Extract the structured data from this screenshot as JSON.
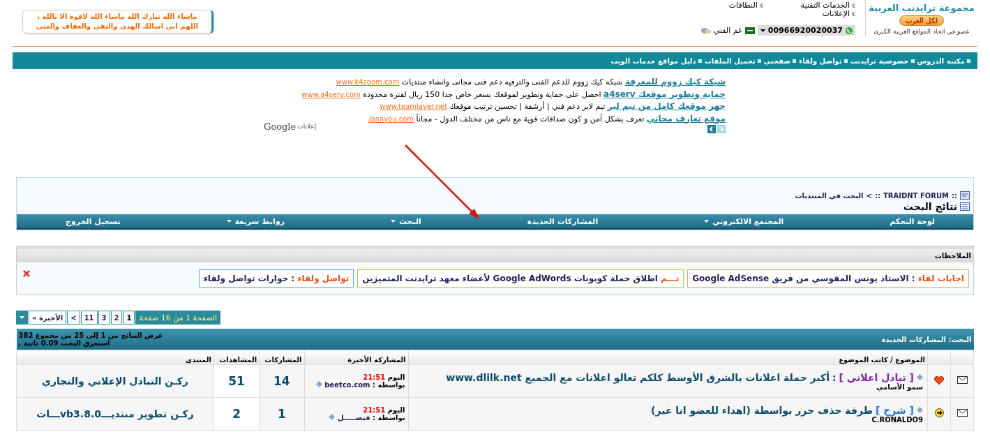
{
  "header": {
    "logo": {
      "title": "مجموعة ترايدنت العربية",
      "button": "لكل العرب",
      "tagline": "عضو في اتحاد المواقع العربية الكبرى"
    },
    "links": [
      "الخدمات التقنية",
      "النطاقات",
      "الإعلانات"
    ],
    "phone": "00966920020037",
    "support": "غم الفني",
    "dua": "ماشاء الله تبارك الله ماشاء الله لاقوة الا بالله ، اللهم اني اسالك الهدى والتقى والعفاف والغنى"
  },
  "nav": [
    "مكتبة الدروس",
    "خصوصية ترايدنت",
    "تواصل ولقاء",
    "صفحتي",
    "تحميل الملفات",
    "دليل مواقع خدمات الويب"
  ],
  "ads": {
    "items": [
      {
        "title": "شبكة كيك زووم للمعرفة",
        "text": "شبكه كيك زووم للدعم الفنى والترفيه دعم فنى مجانى وانشاء منتديات",
        "url": "www.k4zoom.com"
      },
      {
        "title": "حماية وتطوير موقعك a4serv",
        "text": "احصل على حماية وتطوير لموقعك بسعر خاص جدا 150 ريال لفترة محدودة",
        "url": "www.a4serv.com"
      },
      {
        "title": "جهز موقعك كامل من تيم لير",
        "text": "تيم لاير دعم فني | أرشفة | تحسين ترتيب موقعك",
        "url": "www.teamlayer.net"
      },
      {
        "title": "موقع تعارف مجاني",
        "text": "تعرف بشكل آمن و كون صداقات قوية مع ناس من مختلف الدول - مجاناً",
        "url": "anayou.com/"
      }
    ],
    "label": "إعلانات",
    "brand": "Google"
  },
  "breadcrumb": {
    "forum": "TRAIDNT FORUM",
    "sep": "::",
    "arrow": ">",
    "current": "البحث في المنتديات",
    "title": "نتائج البحث"
  },
  "menu": [
    {
      "label": "لوحة التحكم",
      "dropdown": false
    },
    {
      "label": "المجتمع الالكتروني",
      "dropdown": true
    },
    {
      "label": "المشاركات الجديدة",
      "dropdown": false
    },
    {
      "label": "البحث",
      "dropdown": true
    },
    {
      "label": "روابط سريعة",
      "dropdown": true
    },
    {
      "label": "تسجيل الخروج",
      "dropdown": false
    }
  ],
  "notes": {
    "title": "الملاحظات",
    "items": [
      {
        "label": "اجابات لقاء",
        "sep": ":",
        "text": "الاستاذ يونس المقوسي من فريق Google AdSense",
        "color": "#f0a070"
      },
      {
        "label": "تـــم",
        "text": "اطلاق حملة كوبونات Google AdWords لأعضاء معهد ترايدنت المتميزين",
        "color": "#99cc55"
      },
      {
        "label": "تواصل ولقاء",
        "sep": ":",
        "text": "حوارات تواصل ولقاء",
        "color": "#66aacc"
      }
    ]
  },
  "pagination": {
    "summary": "الصفحة 1 من 16 صفحة",
    "pages": [
      {
        "label": "1",
        "selected": true
      },
      {
        "label": "2",
        "selected": false
      },
      {
        "label": "3",
        "selected": false
      },
      {
        "label": "11",
        "selected": false
      },
      {
        "label": ">",
        "selected": false
      },
      {
        "label": "الأخيرة »",
        "selected": false
      }
    ]
  },
  "results": {
    "search_label": "البحث:",
    "search_value": "المشاركات الجديدة",
    "range": "عرض النتائج من 1 إلى 25 من مجموع 382",
    "time": "استغرق البحث 0.09 ثانية .",
    "columns": [
      "الموضوع / كاتب الموضوع",
      "المشاركة الأخيرة",
      "المشاركات",
      "المشاهدات",
      "المنتدى"
    ],
    "rows": [
      {
        "kind": "heart",
        "prefix": {
          "text": "[ تبادل اعلاني ]",
          "color": "#8822aa"
        },
        "sep": ":",
        "title": "أكبر حملة اعلانات بالشرق الأوسط كلكم تعالو اعلانات مع الجميع www.dlilk.net",
        "author": "سمو الأسامي",
        "day": "اليوم",
        "time": "21:51",
        "by": "بواسطة :",
        "user": "beetco.com",
        "replies": "14",
        "views": "51",
        "forum": "ركـن التبادل الإعلاني والتجاري"
      },
      {
        "kind": "arrow",
        "prefix": {
          "text": "[ شرح ]",
          "color": "#2277cc"
        },
        "title": "طرقة حذف حرر بواسطة (اهداء للعضو انا غير)",
        "author": "C.RONALDO9",
        "day": "اليوم",
        "time": "21:51",
        "by": "بواسطة :",
        "user": "فيصـــــل",
        "replies": "1",
        "views": "2",
        "forum": "ركـن تطوير منتديـــvb3.8.0ـــات"
      }
    ]
  }
}
